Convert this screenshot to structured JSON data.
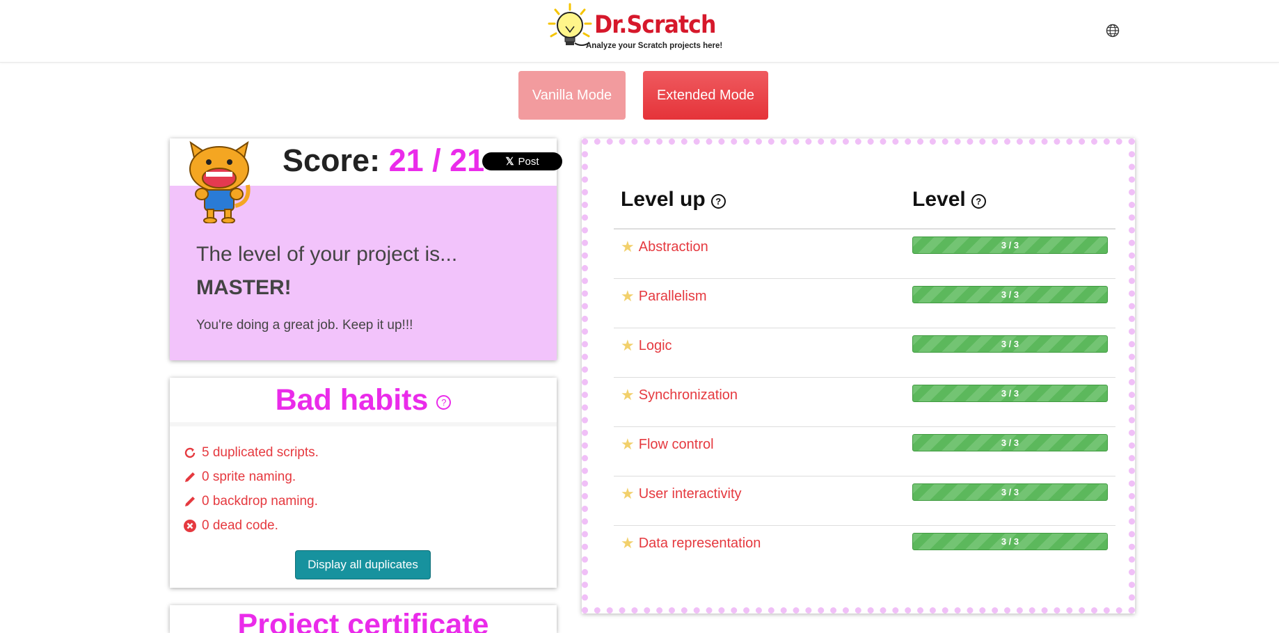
{
  "header": {
    "logo_title": "Dr.Scratch",
    "logo_tagline": "Analyze your Scratch projects here!",
    "language_icon": "globe-icon"
  },
  "modes": {
    "vanilla_label": "Vanilla Mode",
    "extended_label": "Extended Mode"
  },
  "score": {
    "label": "Score:",
    "value": "21 / 21",
    "share_label": "Post",
    "intro": "The level of your project is...",
    "level": "MASTER!",
    "message": "You're doing a great job. Keep it up!!!"
  },
  "bad_habits": {
    "title": "Bad habits",
    "items": [
      {
        "icon": "refresh-icon",
        "text": "5 duplicated scripts."
      },
      {
        "icon": "pencil-icon",
        "text": "0 sprite naming."
      },
      {
        "icon": "pencil-icon",
        "text": "0 backdrop naming."
      },
      {
        "icon": "x-circle-icon",
        "text": "0 dead code."
      }
    ],
    "button_label": "Display all duplicates"
  },
  "next_card": {
    "title": "Project certificate"
  },
  "levels": {
    "col_levelup": "Level up",
    "col_level": "Level",
    "rows": [
      {
        "name": "Abstraction",
        "score": "3 / 3",
        "fraction": 1.0
      },
      {
        "name": "Parallelism",
        "score": "3 / 3",
        "fraction": 1.0
      },
      {
        "name": "Logic",
        "score": "3 / 3",
        "fraction": 1.0
      },
      {
        "name": "Synchronization",
        "score": "3 / 3",
        "fraction": 1.0
      },
      {
        "name": "Flow control",
        "score": "3 / 3",
        "fraction": 1.0
      },
      {
        "name": "User interactivity",
        "score": "3 / 3",
        "fraction": 1.0
      },
      {
        "name": "Data representation",
        "score": "3 / 3",
        "fraction": 1.0
      }
    ]
  },
  "colors": {
    "brand_red": "#d6182b",
    "accent_pink": "#ea2bea",
    "score_card_bg": "#f2c3fb",
    "progress_green": "#5cb85c",
    "button_teal": "#17929e"
  }
}
